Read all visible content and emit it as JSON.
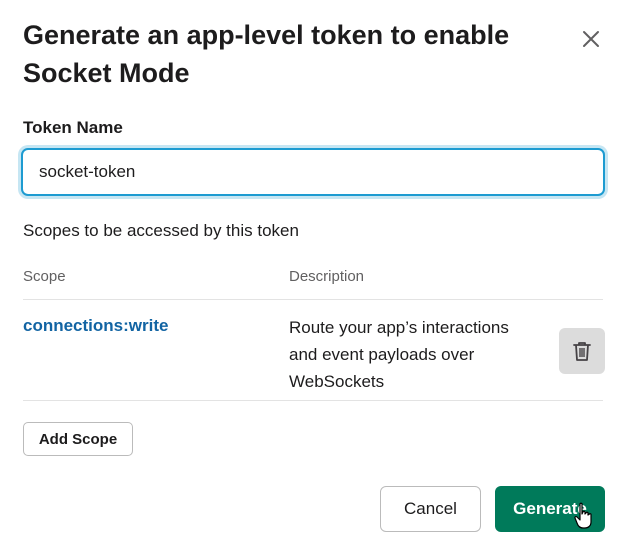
{
  "dialog": {
    "title": "Generate an app-level token to enable Socket Mode",
    "close_icon": "close-icon"
  },
  "token_field": {
    "label": "Token Name",
    "value": "socket-token"
  },
  "scopes": {
    "heading": "Scopes to be accessed by this token",
    "columns": {
      "scope": "Scope",
      "description": "Description"
    },
    "rows": [
      {
        "scope": "connections:write",
        "description": "Route your app’s interactions and event payloads over WebSockets",
        "delete_icon": "trash-icon"
      }
    ],
    "add_label": "Add Scope"
  },
  "footer": {
    "cancel_label": "Cancel",
    "generate_label": "Generate"
  },
  "colors": {
    "accent_link": "#1264a3",
    "primary_button": "#007a5a",
    "focus_border": "#1d9bd1"
  }
}
